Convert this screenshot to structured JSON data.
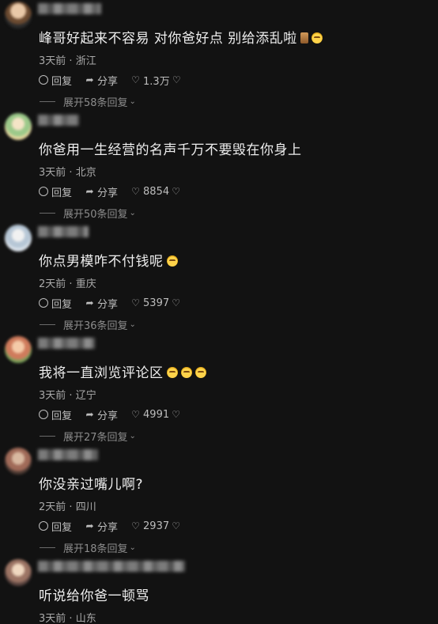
{
  "comments": [
    {
      "content": "峰哥好起来不容易 对你爸好点 别给添乱啦",
      "time": "3天前",
      "location": "浙江",
      "reply": "回复",
      "share": "分享",
      "likes": "1.3万",
      "expand": "展开58条回复"
    },
    {
      "content": "你爸用一生经营的名声千万不要毁在你身上",
      "time": "3天前",
      "location": "北京",
      "reply": "回复",
      "share": "分享",
      "likes": "8854",
      "expand": "展开50条回复"
    },
    {
      "content": "你点男模咋不付钱呢",
      "time": "2天前",
      "location": "重庆",
      "reply": "回复",
      "share": "分享",
      "likes": "5397",
      "expand": "展开36条回复"
    },
    {
      "content": "我将一直浏览评论区",
      "time": "3天前",
      "location": "辽宁",
      "reply": "回复",
      "share": "分享",
      "likes": "4991",
      "expand": "展开27条回复"
    },
    {
      "content": "你没亲过嘴儿啊?",
      "time": "2天前",
      "location": "四川",
      "reply": "回复",
      "share": "分享",
      "likes": "2937",
      "expand": "展开18条回复"
    },
    {
      "content": "听说给你爸一顿骂",
      "time": "3天前",
      "location": "山东"
    }
  ],
  "separator": " · ",
  "icons": {
    "reply": "comment-bubble-icon",
    "share": "share-arrow-icon",
    "like": "heart-icon",
    "dislike": "broken-heart-icon",
    "expand": "chevron-down-icon"
  }
}
